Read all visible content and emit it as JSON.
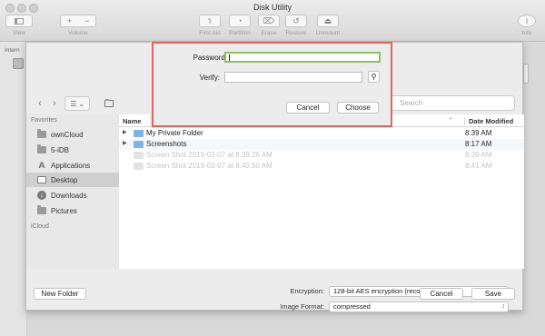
{
  "window": {
    "title": "Disk Utility"
  },
  "toolbar": {
    "view_label": "View",
    "volume_label": "Volume",
    "info_label": "Info",
    "plus": "+",
    "minus": "−",
    "actions": [
      {
        "label": "First Aid",
        "icon": "stethoscope-icon",
        "glyph": "⚕"
      },
      {
        "label": "Partition",
        "icon": "pie-icon",
        "glyph": "◔"
      },
      {
        "label": "Erase",
        "icon": "erase-icon",
        "glyph": "⌦"
      },
      {
        "label": "Restore",
        "icon": "restore-icon",
        "glyph": "↺"
      },
      {
        "label": "Unmount",
        "icon": "eject-icon",
        "glyph": "⏏"
      }
    ],
    "info_glyph": "i"
  },
  "du_sidebar": {
    "section_label": "Intern"
  },
  "sheet": {
    "nav": {
      "back": "‹",
      "forward": "›",
      "view_glyph": "☰",
      "view_chevron": "⌄"
    },
    "search_placeholder": "Search",
    "sidebar": {
      "favorites_label": "Favorites",
      "items": [
        {
          "label": "ownCloud",
          "icon": "folder-icon"
        },
        {
          "label": "5-iDB",
          "icon": "folder-icon"
        },
        {
          "label": "Applications",
          "icon": "applications-icon"
        },
        {
          "label": "Desktop",
          "icon": "desktop-icon",
          "selected": true
        },
        {
          "label": "Downloads",
          "icon": "downloads-icon"
        },
        {
          "label": "Pictures",
          "icon": "folder-icon"
        }
      ],
      "icloud_label": "iCloud"
    },
    "files": {
      "header_name": "Name",
      "header_date": "Date Modified",
      "sort_glyph": "⌃",
      "rows": [
        {
          "name": "My Private Folder",
          "date": "8:39 AM",
          "folder": true
        },
        {
          "name": "Screenshots",
          "date": "8:17 AM",
          "folder": true
        },
        {
          "name": "Screen Shot 2019-03-07 at 8.39.26 AM",
          "date": "8:39 AM",
          "folder": false
        },
        {
          "name": "Screen Shot 2019-03-07 at 8.40.50 AM",
          "date": "8:41 AM",
          "folder": false
        }
      ]
    },
    "encryption_label": "Encryption:",
    "encryption_value": "128-bit AES encryption (recommended)",
    "format_label": "Image Format:",
    "format_value": "compressed",
    "popup_arrow": "↕",
    "new_folder_label": "New Folder",
    "cancel_label": "Cancel",
    "save_label": "Save"
  },
  "password_dialog": {
    "password_label": "Password:",
    "password_value": "",
    "verify_label": "Verify:",
    "verify_value": "",
    "key_glyph": "⚲",
    "cancel_label": "Cancel",
    "choose_label": "Choose",
    "highlight_color": "#e3655f",
    "focus_color": "#8ec15f"
  }
}
